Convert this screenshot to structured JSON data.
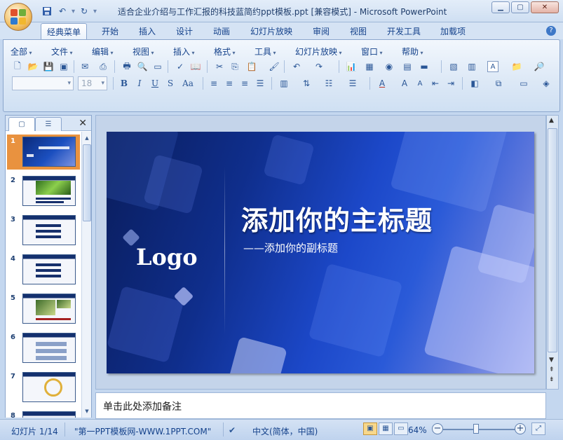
{
  "window": {
    "title": "适合企业介绍与工作汇报的科技蓝简约ppt模板.ppt [兼容模式] - Microsoft PowerPoint",
    "controls": [
      "minimize",
      "maximize",
      "close"
    ]
  },
  "quick_access": [
    {
      "icon": "save-icon"
    },
    {
      "icon": "undo-icon"
    },
    {
      "icon": "redo-icon"
    },
    {
      "icon": "customize-icon"
    }
  ],
  "tabs": [
    "经典菜单",
    "开始",
    "插入",
    "设计",
    "动画",
    "幻灯片放映",
    "审阅",
    "视图",
    "开发工具",
    "加载项"
  ],
  "active_tab": "经典菜单",
  "menu": [
    "全部",
    "文件",
    "编辑",
    "视图",
    "插入",
    "格式",
    "工具",
    "幻灯片放映",
    "窗口",
    "帮助"
  ],
  "font_controls": {
    "font_name": "",
    "font_size": "18"
  },
  "format_buttons": [
    "B",
    "I",
    "U",
    "S",
    "Aa"
  ],
  "toolbar_letter": "A",
  "slide_panel": {
    "tabs": [
      "slides-icon",
      "outline-icon"
    ],
    "thumbnails": [
      {
        "number": "1",
        "selected": true
      },
      {
        "number": "2",
        "selected": false
      },
      {
        "number": "3",
        "selected": false
      },
      {
        "number": "4",
        "selected": false
      },
      {
        "number": "5",
        "selected": false
      },
      {
        "number": "6",
        "selected": false
      },
      {
        "number": "7",
        "selected": false
      },
      {
        "number": "8",
        "selected": false
      }
    ]
  },
  "slide": {
    "logo": "Logo",
    "title": "添加你的主标题",
    "subtitle": "——添加你的副标题"
  },
  "notes": {
    "placeholder": "单击此处添加备注"
  },
  "status": {
    "slide_count": "幻灯片 1/14",
    "theme": "\"第一PPT模板网-WWW.1PPT.COM\"",
    "language": "中文(简体，中国)",
    "zoom": "64%",
    "zoom_fraction": 0.44
  },
  "colors": {
    "accent": "#15428b",
    "selected_thumb": "#e9923f",
    "slide_dark": "#0a1d5c",
    "slide_light": "#9ba8ee"
  }
}
